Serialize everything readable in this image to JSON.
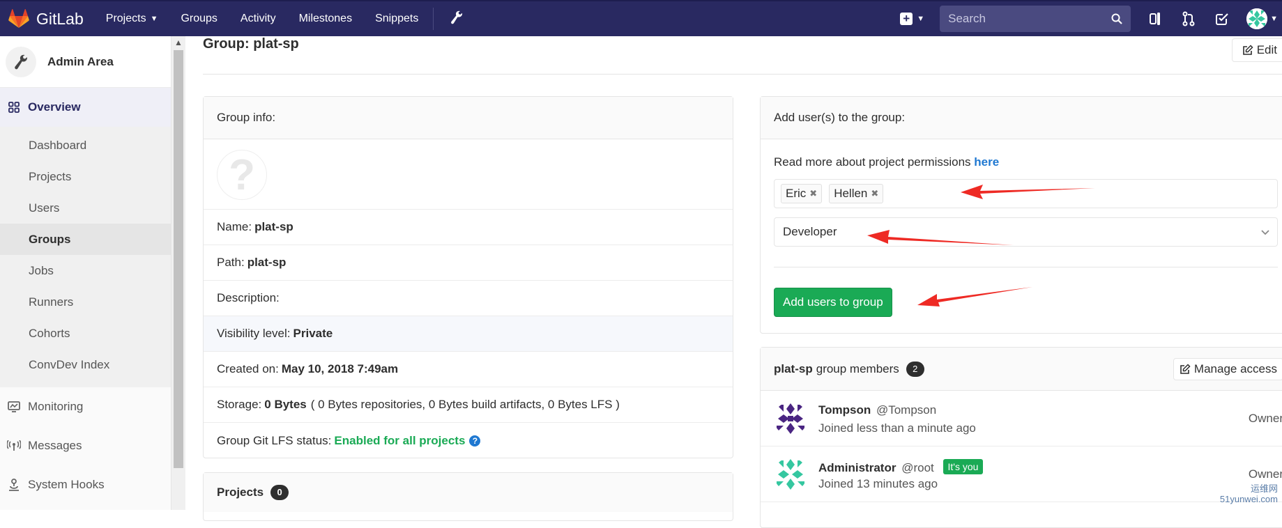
{
  "navbar": {
    "brand": "GitLab",
    "links": [
      {
        "label": "Projects",
        "has_caret": true
      },
      {
        "label": "Groups"
      },
      {
        "label": "Activity"
      },
      {
        "label": "Milestones"
      },
      {
        "label": "Snippets"
      }
    ],
    "search_placeholder": "Search"
  },
  "sidebar": {
    "title": "Admin Area",
    "overview": "Overview",
    "items": [
      "Dashboard",
      "Projects",
      "Users",
      "Groups",
      "Jobs",
      "Runners",
      "Cohorts",
      "ConvDev Index"
    ],
    "sections": [
      "Monitoring",
      "Messages",
      "System Hooks"
    ]
  },
  "page": {
    "title": "Group: plat-sp",
    "edit_label": "Edit"
  },
  "group_info": {
    "header": "Group info:",
    "name_label": "Name:",
    "name_value": "plat-sp",
    "path_label": "Path:",
    "path_value": "plat-sp",
    "description_label": "Description:",
    "visibility_label": "Visibility level:",
    "visibility_value": "Private",
    "created_label": "Created on:",
    "created_value": "May 10, 2018 7:49am",
    "storage_label": "Storage:",
    "storage_value": "0 Bytes",
    "storage_detail": "( 0 Bytes repositories, 0 Bytes build artifacts, 0 Bytes LFS )",
    "lfs_label": "Group Git LFS status:",
    "lfs_value": "Enabled for all projects"
  },
  "projects_panel": {
    "header": "Projects",
    "count": "0"
  },
  "add_users": {
    "header": "Add user(s) to the group:",
    "perm_text": "Read more about project permissions",
    "perm_link": "here",
    "tokens": [
      "Eric",
      "Hellen"
    ],
    "role_selected": "Developer",
    "submit_label": "Add users to group"
  },
  "members": {
    "group_name": "plat-sp",
    "label": "group members",
    "count": "2",
    "manage_label": "Manage access",
    "list": [
      {
        "name": "Tompson",
        "username": "@Tompson",
        "joined": "Joined less than a minute ago",
        "role": "Owner",
        "is_you": false
      },
      {
        "name": "Administrator",
        "username": "@root",
        "joined": "Joined 13 minutes ago",
        "role": "Owner",
        "is_you": true
      }
    ],
    "you_badge": "It's you"
  },
  "watermark": {
    "line1": "运维网",
    "line2": "51yunwei.com"
  },
  "colors": {
    "navbar": "#292961",
    "green": "#1aaa55",
    "link": "#1f78d1",
    "arrow": "#ee2a24"
  }
}
